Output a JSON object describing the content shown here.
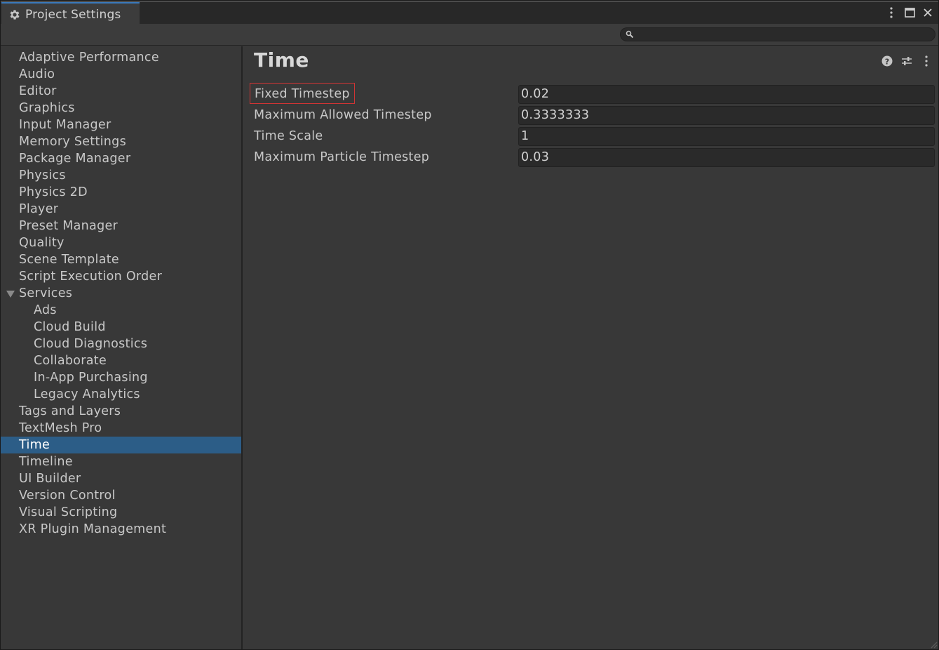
{
  "window": {
    "tab_title": "Project Settings"
  },
  "search": {
    "value": "",
    "placeholder": ""
  },
  "sidebar": {
    "items": [
      {
        "label": "Adaptive Performance"
      },
      {
        "label": "Audio"
      },
      {
        "label": "Editor"
      },
      {
        "label": "Graphics"
      },
      {
        "label": "Input Manager"
      },
      {
        "label": "Memory Settings"
      },
      {
        "label": "Package Manager"
      },
      {
        "label": "Physics"
      },
      {
        "label": "Physics 2D"
      },
      {
        "label": "Player"
      },
      {
        "label": "Preset Manager"
      },
      {
        "label": "Quality"
      },
      {
        "label": "Scene Template"
      },
      {
        "label": "Script Execution Order"
      },
      {
        "label": "Services"
      },
      {
        "label": "Ads"
      },
      {
        "label": "Cloud Build"
      },
      {
        "label": "Cloud Diagnostics"
      },
      {
        "label": "Collaborate"
      },
      {
        "label": "In-App Purchasing"
      },
      {
        "label": "Legacy Analytics"
      },
      {
        "label": "Tags and Layers"
      },
      {
        "label": "TextMesh Pro"
      },
      {
        "label": "Time"
      },
      {
        "label": "Timeline"
      },
      {
        "label": "UI Builder"
      },
      {
        "label": "Version Control"
      },
      {
        "label": "Visual Scripting"
      },
      {
        "label": "XR Plugin Management"
      }
    ],
    "selected": "Time",
    "expanded_group": "Services"
  },
  "content": {
    "title": "Time",
    "properties": [
      {
        "label": "Fixed Timestep",
        "value": "0.02",
        "highlighted": true
      },
      {
        "label": "Maximum Allowed Timestep",
        "value": "0.3333333"
      },
      {
        "label": "Time Scale",
        "value": "1"
      },
      {
        "label": "Maximum Particle Timestep",
        "value": "0.03"
      }
    ]
  },
  "colors": {
    "selection": "#2c5d87",
    "highlight_border": "#d03434",
    "panel_bg": "#383838"
  }
}
